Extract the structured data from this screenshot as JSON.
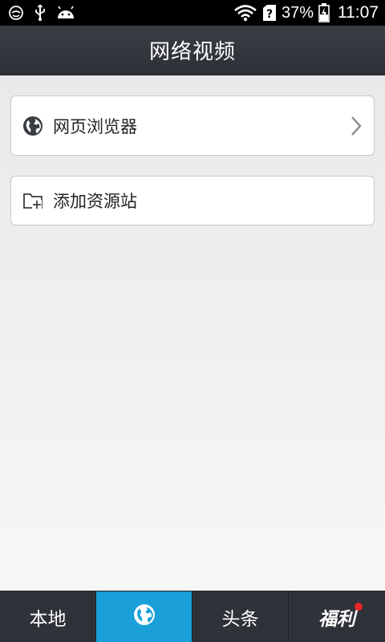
{
  "status_bar": {
    "battery_percent": "37%",
    "time": "11:07"
  },
  "header": {
    "title": "网络视频"
  },
  "main": {
    "items": [
      {
        "label": "网页浏览器",
        "icon": "globe-icon"
      },
      {
        "label": "添加资源站",
        "icon": "folder-add-icon"
      }
    ]
  },
  "bottom_nav": {
    "tabs": [
      {
        "label": "本地"
      },
      {
        "label": "",
        "icon": "globe-icon",
        "active": true
      },
      {
        "label": "头条"
      },
      {
        "label": "福利",
        "badge": "red-dot"
      }
    ]
  },
  "colors": {
    "accent": "#1a9fd8",
    "header_bg": "#33363c",
    "nav_bg": "#2f3238",
    "badge": "#e8262b"
  }
}
